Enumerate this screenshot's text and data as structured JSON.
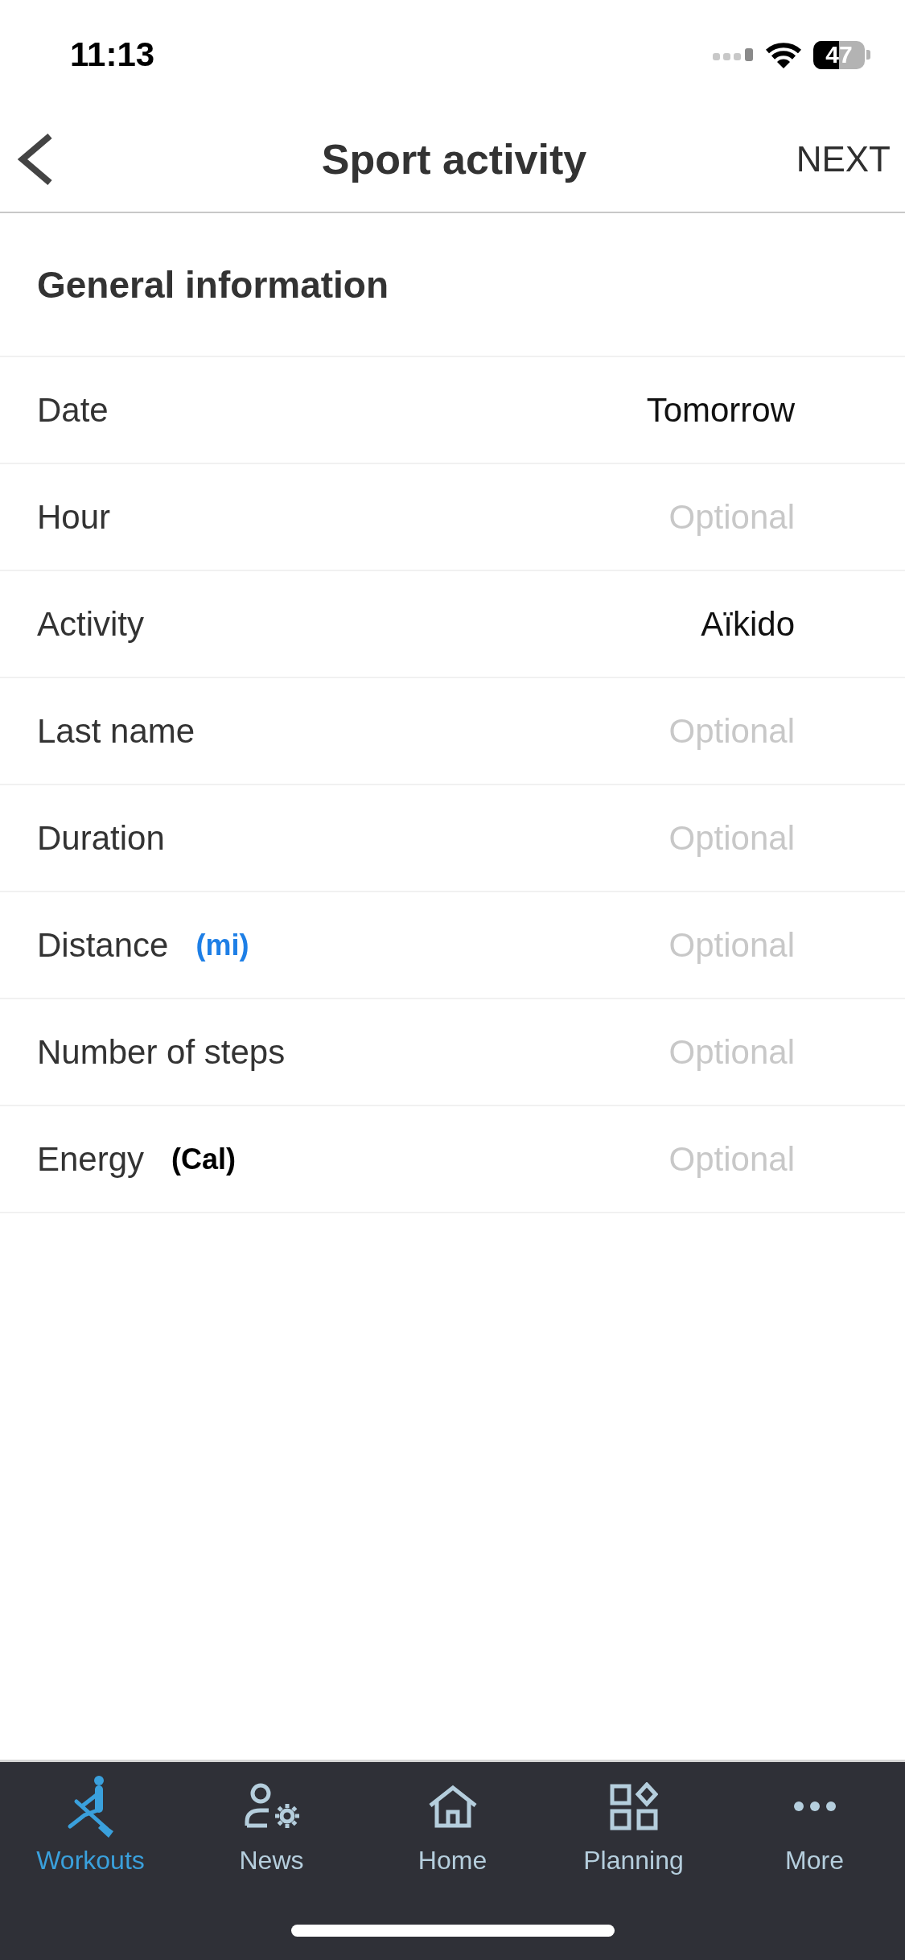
{
  "status_bar": {
    "time": "11:13",
    "battery": "47"
  },
  "nav_bar": {
    "title": "Sport activity",
    "action": "NEXT"
  },
  "section": {
    "title": "General information"
  },
  "fields": [
    {
      "label": "Date",
      "value": "Tomorrow"
    },
    {
      "label": "Hour",
      "placeholder": "Optional"
    },
    {
      "label": "Activity",
      "value": "Aïkido"
    },
    {
      "label": "Last name",
      "placeholder": "Optional"
    },
    {
      "label": "Duration",
      "placeholder": "Optional"
    },
    {
      "label": "Distance",
      "unit": {
        "text": "(mi)",
        "kind": "link"
      },
      "placeholder": "Optional"
    },
    {
      "label": "Number of steps",
      "placeholder": "Optional"
    },
    {
      "label": "Energy",
      "unit": {
        "text": "(Cal)",
        "kind": "plain"
      },
      "placeholder": "Optional"
    }
  ],
  "tab_bar": [
    {
      "label": "Workouts",
      "kind": "rowing",
      "selected": true
    },
    {
      "label": "News",
      "kind": "profile",
      "selected": false
    },
    {
      "label": "Home",
      "kind": "home",
      "selected": false
    },
    {
      "label": "Planning",
      "kind": "grid",
      "selected": false
    },
    {
      "label": "More",
      "kind": "more",
      "selected": false
    }
  ]
}
